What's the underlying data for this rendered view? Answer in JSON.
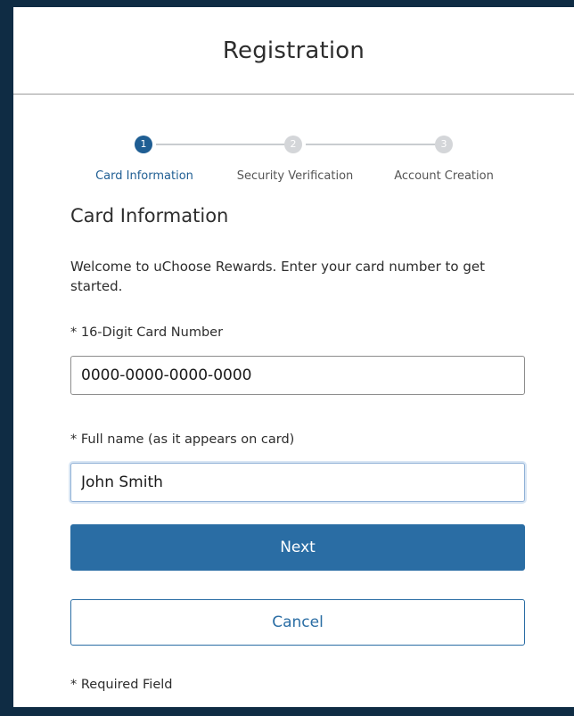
{
  "header": {
    "title": "Registration"
  },
  "stepper": {
    "steps": [
      {
        "number": "1",
        "label": "Card Information",
        "state": "active"
      },
      {
        "number": "2",
        "label": "Security Verification",
        "state": "pending"
      },
      {
        "number": "3",
        "label": "Account Creation",
        "state": "pending"
      }
    ]
  },
  "form": {
    "section_title": "Card Information",
    "intro": "Welcome to uChoose Rewards. Enter your card number to get started.",
    "card_number": {
      "label": "* 16-Digit Card Number",
      "value": "0000-0000-0000-0000"
    },
    "full_name": {
      "label": "* Full name (as it appears on card)",
      "value": "John Smith"
    },
    "next_label": "Next",
    "cancel_label": "Cancel",
    "required_note": "* Required Field"
  },
  "colors": {
    "accent": "#2a6da4",
    "frame": "#0f2c44",
    "step_inactive": "#d4d6d9"
  }
}
